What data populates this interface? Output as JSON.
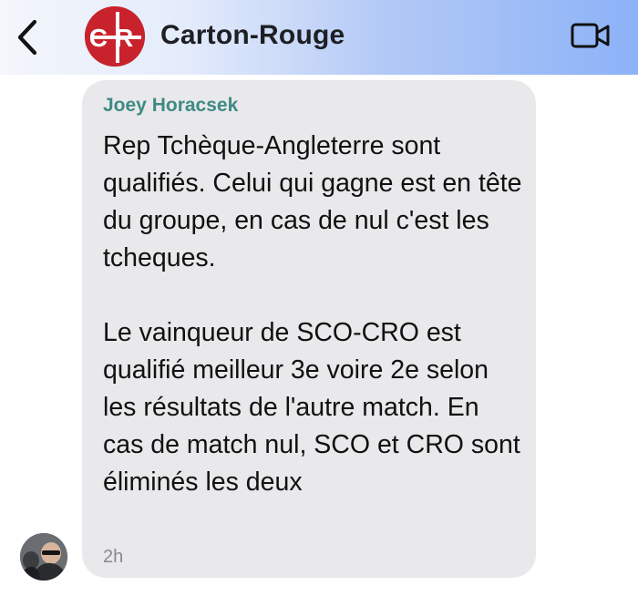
{
  "header": {
    "title": "Carton-Rouge",
    "back_icon": "chevron-left-icon",
    "call_icon": "video-camera-icon",
    "group_avatar_letters": "CR"
  },
  "message": {
    "sender": "Joey Horacsek",
    "text": "Rep Tchèque-Angleterre sont qualifiés. Celui qui gagne est en tête du groupe, en cas de nul c'est les tcheques.\n\nLe vainqueur de SCO-CRO est qualifié meilleur 3e voire 2e selon les résultats de l'autre match. En cas de match nul, SCO et CRO sont éliminés les deux",
    "time": "2h"
  },
  "colors": {
    "bubble": "#e9e9eb",
    "sender": "#3f8a84",
    "brand_red": "#c8232c"
  }
}
